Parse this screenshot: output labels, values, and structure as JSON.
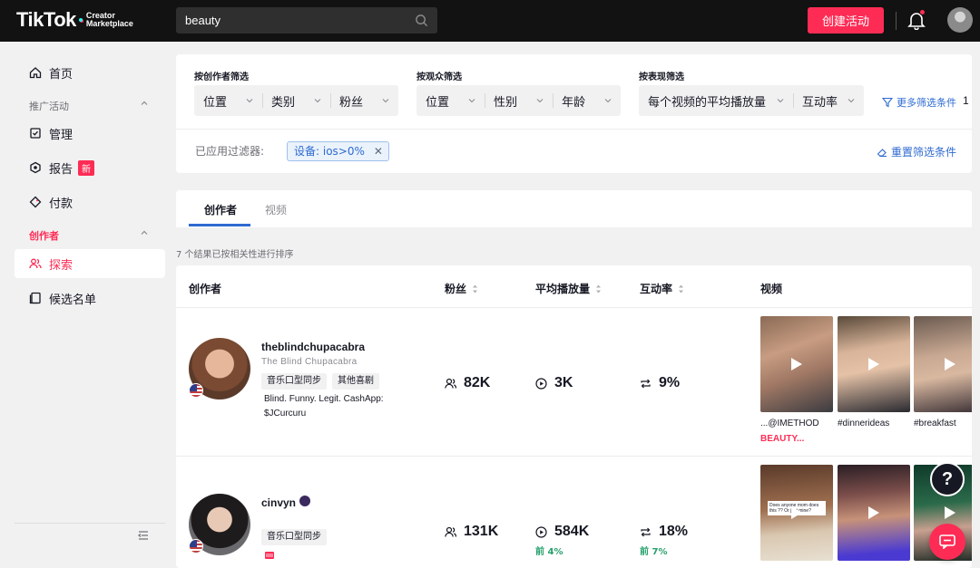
{
  "app": {
    "logo_main": "TikTok",
    "logo_sub_1": "Creator",
    "logo_sub_2": "Marketplace"
  },
  "topbar": {
    "search_value": "beauty",
    "create_button": "创建活动"
  },
  "sidebar": {
    "home": "首页",
    "section_campaign": "推广活动",
    "manage": "管理",
    "report": "报告",
    "report_badge": "新",
    "payment": "付款",
    "section_creator": "创作者",
    "explore": "探索",
    "shortlist": "候选名单"
  },
  "filters": {
    "by_creator": {
      "label": "按创作者筛选",
      "options": [
        "位置",
        "类别",
        "粉丝"
      ]
    },
    "by_audience": {
      "label": "按观众筛选",
      "options": [
        "位置",
        "性别",
        "年龄"
      ]
    },
    "by_performance": {
      "label": "按表现筛选",
      "options": [
        "每个视频的平均播放量",
        "互动率"
      ]
    },
    "more_filters": "更多筛选条件",
    "more_count": "1",
    "applied_label": "已应用过滤器:",
    "applied_chip": "设备: ios>0%",
    "reset": "重置筛选条件"
  },
  "tabs": {
    "creators": "创作者",
    "videos": "视频"
  },
  "results_note": "7 个结果已按相关性进行排序",
  "table": {
    "headers": {
      "creator": "创作者",
      "followers": "粉丝",
      "avg_views": "平均播放量",
      "engagement": "互动率",
      "videos": "视频"
    },
    "rows": [
      {
        "handle": "theblindchupacabra",
        "display_name": "The  Blind  Chupacabra",
        "tags": [
          "音乐口型同步",
          "其他喜剧"
        ],
        "bio_line1": "Blind. Funny. Legit. CashApp:",
        "bio_line2": "$JCurcuru",
        "followers": "82K",
        "avg_views": "3K",
        "engagement": "9%",
        "video_captions": [
          "...@IMETHOD",
          "#dinnerideas",
          "#breakfast"
        ],
        "video_caption_extra": "BEAUTY..."
      },
      {
        "handle": "cinvyn",
        "tags": [
          "音乐口型同步"
        ],
        "followers": "131K",
        "avg_views": "584K",
        "avg_views_rank": "前 4%",
        "engagement": "18%",
        "engagement_rank": "前 7%",
        "video_overlay_text": "Does anyone mom does this ?? Or just mine?"
      }
    ]
  },
  "help_button": "?",
  "colors": {
    "brand": "#fe2c55",
    "link": "#2e6ad1",
    "positive": "#25a06b"
  }
}
